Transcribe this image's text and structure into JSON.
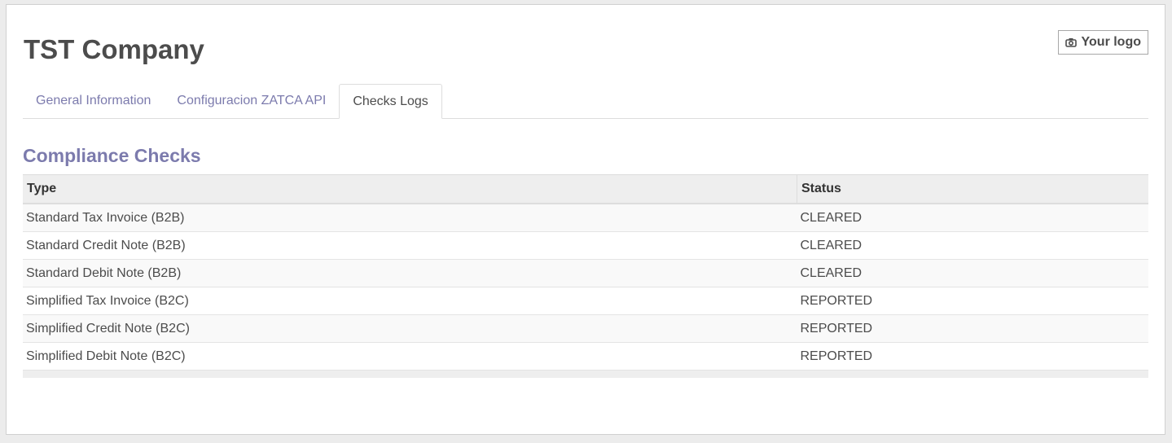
{
  "company": {
    "name": "TST Company"
  },
  "logo_button": {
    "label": "Your logo",
    "icon": "camera-icon"
  },
  "tabs": [
    {
      "label": "General Information",
      "active": false
    },
    {
      "label": "Configuracion ZATCA API",
      "active": false
    },
    {
      "label": "Checks Logs",
      "active": true
    }
  ],
  "section": {
    "title": "Compliance Checks"
  },
  "table": {
    "columns": [
      "Type",
      "Status"
    ],
    "rows": [
      {
        "type": "Standard Tax Invoice (B2B)",
        "status": "CLEARED"
      },
      {
        "type": "Standard Credit Note (B2B)",
        "status": "CLEARED"
      },
      {
        "type": "Standard Debit Note (B2B)",
        "status": "CLEARED"
      },
      {
        "type": "Simplified Tax Invoice (B2C)",
        "status": "REPORTED"
      },
      {
        "type": "Simplified Credit Note (B2C)",
        "status": "REPORTED"
      },
      {
        "type": "Simplified Debit Note (B2C)",
        "status": "REPORTED"
      }
    ]
  },
  "colors": {
    "accent": "#7c7bad",
    "text": "#4c4c4c",
    "header_bg": "#eeeeee"
  }
}
